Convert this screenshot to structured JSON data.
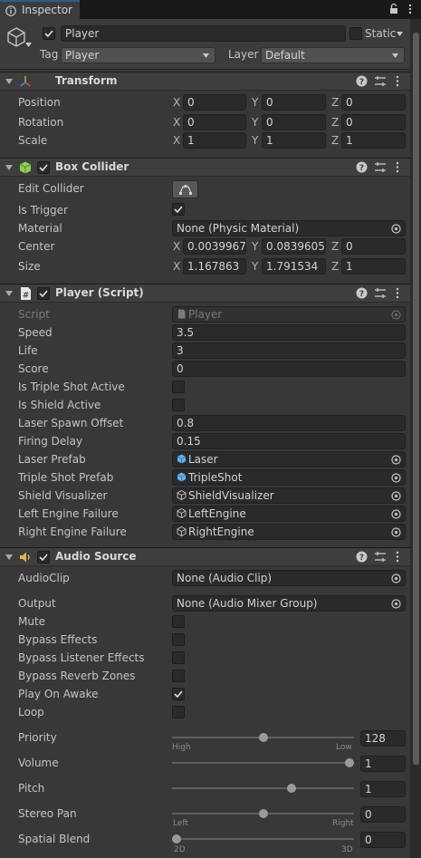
{
  "tab": {
    "label": "Inspector"
  },
  "gameobject": {
    "active": true,
    "name": "Player",
    "static_label": "Static",
    "static_checked": false,
    "tag_label": "Tag",
    "tag_value": "Player",
    "layer_label": "Layer",
    "layer_value": "Default"
  },
  "transform": {
    "title": "Transform",
    "rows": [
      {
        "label": "Position",
        "x": "0",
        "y": "0",
        "z": "0"
      },
      {
        "label": "Rotation",
        "x": "0",
        "y": "0",
        "z": "0"
      },
      {
        "label": "Scale",
        "x": "1",
        "y": "1",
        "z": "1"
      }
    ]
  },
  "axis": {
    "x": "X",
    "y": "Y",
    "z": "Z"
  },
  "box_collider": {
    "title": "Box Collider",
    "enabled": true,
    "edit_label": "Edit Collider",
    "is_trigger_label": "Is Trigger",
    "is_trigger": true,
    "material_label": "Material",
    "material_value": "None (Physic Material)",
    "center_label": "Center",
    "center": {
      "x": "0.0039967(",
      "y": "0.0839605:",
      "z": "0"
    },
    "size_label": "Size",
    "size": {
      "x": "1.167863",
      "y": "1.791534",
      "z": "1"
    }
  },
  "player_script": {
    "title": "Player (Script)",
    "enabled": true,
    "script_label": "Script",
    "script_value": "Player",
    "speed_label": "Speed",
    "speed": "3.5",
    "life_label": "Life",
    "life": "3",
    "score_label": "Score",
    "score": "0",
    "triple_label": "Is Triple Shot Active",
    "triple": false,
    "shield_label": "Is Shield Active",
    "shield": false,
    "laser_offset_label": "Laser Spawn Offset",
    "laser_offset": "0.8",
    "firing_delay_label": "Firing Delay",
    "firing_delay": "0.15",
    "laser_prefab_label": "Laser Prefab",
    "laser_prefab": "Laser",
    "triple_prefab_label": "Triple Shot Prefab",
    "triple_prefab": "TripleShot",
    "shield_vis_label": "Shield Visualizer",
    "shield_vis": "ShieldVisualizer",
    "left_engine_label": "Left Engine Failure",
    "left_engine": "LeftEngine",
    "right_engine_label": "Right Engine Failure",
    "right_engine": "RightEngine"
  },
  "audio_source": {
    "title": "Audio Source",
    "enabled": true,
    "clip_label": "AudioClip",
    "clip_value": "None (Audio Clip)",
    "output_label": "Output",
    "output_value": "None (Audio Mixer Group)",
    "mute_label": "Mute",
    "mute": false,
    "bypass_effects_label": "Bypass Effects",
    "bypass_effects": false,
    "bypass_listener_label": "Bypass Listener Effects",
    "bypass_listener": false,
    "bypass_reverb_label": "Bypass Reverb Zones",
    "bypass_reverb": false,
    "play_on_awake_label": "Play On Awake",
    "play_on_awake": true,
    "loop_label": "Loop",
    "loop": false,
    "priority_label": "Priority",
    "priority": "128",
    "priority_fraction": 0.5,
    "priority_high": "High",
    "priority_low": "Low",
    "volume_label": "Volume",
    "volume": "1",
    "volume_fraction": 1.0,
    "pitch_label": "Pitch",
    "pitch": "1",
    "pitch_fraction": 0.6667,
    "stereo_label": "Stereo Pan",
    "stereo": "0",
    "stereo_fraction": 0.5,
    "stereo_left": "Left",
    "stereo_right": "Right",
    "spatial_label": "Spatial Blend",
    "spatial": "0",
    "spatial_fraction": 0.0,
    "spatial_2d": "2D",
    "spatial_3d": "3D"
  },
  "colors": {
    "accent": "#2c5d87",
    "background": "#383838",
    "field": "#2a2a2a"
  }
}
